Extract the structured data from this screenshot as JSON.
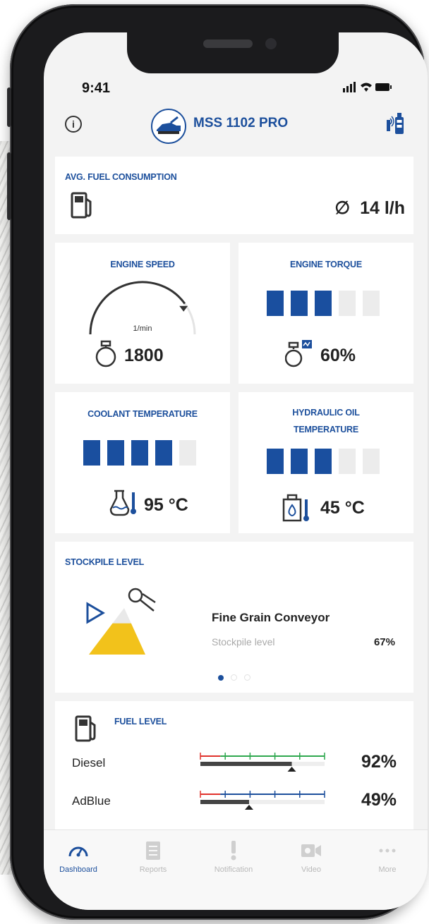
{
  "status_bar": {
    "time": "9:41",
    "icons": "▐▌ ◠ ▬"
  },
  "header": {
    "title": "MSS 1102 PRO"
  },
  "fuel_consumption": {
    "label": "AVG. FUEL CONSUMPTION",
    "value": "∅  14 l/h"
  },
  "engine_speed": {
    "label": "ENGINE SPEED",
    "unit": "1/min",
    "value": "1800",
    "gauge_fraction": 0.8
  },
  "engine_torque": {
    "label": "ENGINE TORQUE",
    "value": "60%",
    "segments_on": 3,
    "segments_total": 5
  },
  "coolant": {
    "label": "COOLANT TEMPERATURE",
    "value": "95 °C",
    "segments_on": 4,
    "segments_total": 5
  },
  "hydraulic_oil": {
    "label_line1": "HYDRAULIC OIL",
    "label_line2": "TEMPERATURE",
    "value": "45 °C",
    "segments_on": 3,
    "segments_total": 5
  },
  "stockpile": {
    "label": "STOCKPILE LEVEL",
    "conveyor": "Fine Grain Conveyor",
    "sub_label": "Stockpile level",
    "value": "67%",
    "page_index": 1,
    "page_count": 3
  },
  "fuel_level": {
    "label": "FUEL LEVEL",
    "items": [
      {
        "name": "Diesel",
        "value": "92%",
        "fraction": 0.92,
        "scale_color": "#2fa84f"
      },
      {
        "name": "AdBlue",
        "value": "49%",
        "fraction": 0.49,
        "scale_color": "#1c4f9c"
      }
    ]
  },
  "nav": [
    {
      "label": "Dashboard",
      "icon": "speedometer-icon",
      "active": true
    },
    {
      "label": "Reports",
      "icon": "document-icon",
      "active": false
    },
    {
      "label": "Notification",
      "icon": "exclamation-icon",
      "active": false
    },
    {
      "label": "Video",
      "icon": "video-camera-icon",
      "active": false
    },
    {
      "label": "More",
      "icon": "more-dots-icon",
      "active": false
    }
  ],
  "colors": {
    "brand_blue": "#1c4f9c",
    "segment_off": "#ececec",
    "stockpile_yellow": "#f2c21b",
    "warning_red": "#e0322c"
  }
}
